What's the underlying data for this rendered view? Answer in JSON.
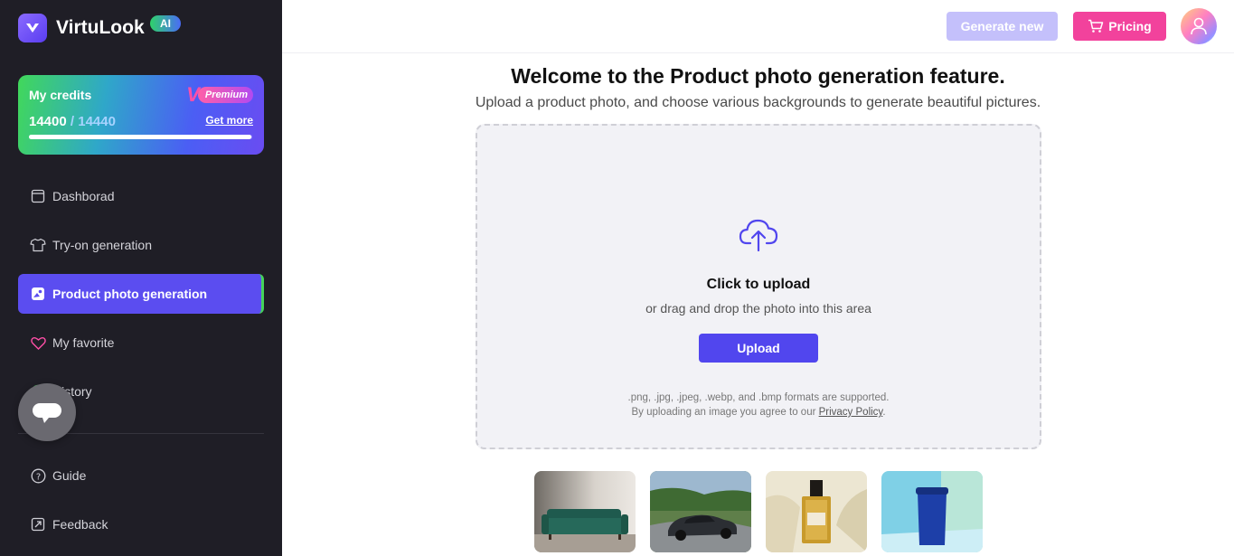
{
  "brand": {
    "name": "VirtuLook",
    "badge": "AI"
  },
  "credits": {
    "title": "My credits",
    "premium_label": "Premium",
    "used": "14400",
    "separator": " / ",
    "total": "14440",
    "get_more": "Get more",
    "progress_fraction": 0.997
  },
  "nav": {
    "items": [
      {
        "label": "Dashborad",
        "icon": "dashboard-icon"
      },
      {
        "label": "Try-on generation",
        "icon": "tshirt-icon"
      },
      {
        "label": "Product photo generation",
        "icon": "product-photo-icon",
        "active": true
      },
      {
        "label": "My favorite",
        "icon": "heart-icon"
      },
      {
        "label": "History",
        "icon": "history-icon"
      }
    ],
    "bottom": [
      {
        "label": "Guide",
        "icon": "question-icon"
      },
      {
        "label": "Feedback",
        "icon": "feedback-icon"
      }
    ]
  },
  "header": {
    "generate_new": "Generate new",
    "pricing": "Pricing"
  },
  "main": {
    "title": "Welcome to the Product photo generation feature.",
    "subtitle": "Upload a product photo, and choose various backgrounds to generate beautiful pictures.",
    "upload": {
      "heading": "Click to upload",
      "hint": "or drag and drop the photo into this area",
      "button": "Upload",
      "formats": ".png, .jpg, .jpeg, .webp, and .bmp formats are supported.",
      "agree_prefix": "By uploading an image you agree to our ",
      "privacy_link": "Privacy Policy",
      "agree_suffix": "."
    },
    "samples": [
      "sofa",
      "car",
      "perfume",
      "cup"
    ]
  },
  "colors": {
    "sidebar_bg": "#1f1e26",
    "accent": "#5b4df0",
    "pricing": "#f2429c",
    "generate_new": "#c4c0fb"
  }
}
